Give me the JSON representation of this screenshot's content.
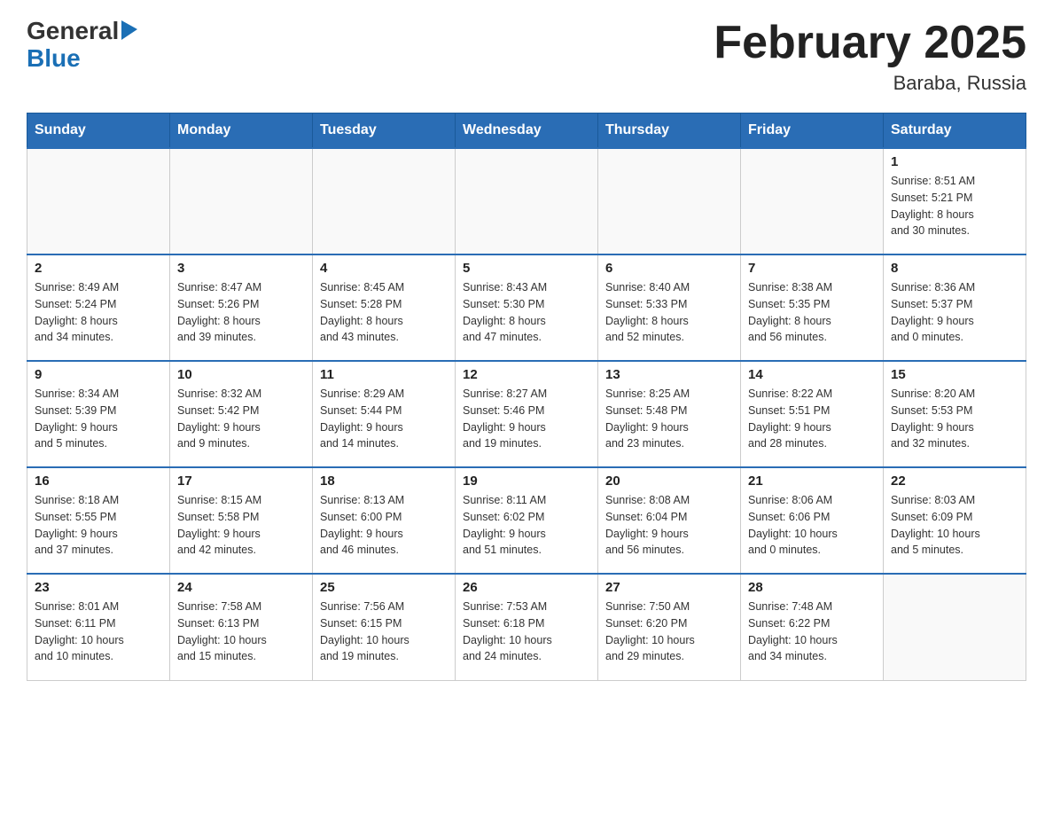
{
  "header": {
    "logo_general": "General",
    "logo_blue": "Blue",
    "title": "February 2025",
    "subtitle": "Baraba, Russia"
  },
  "days_of_week": [
    "Sunday",
    "Monday",
    "Tuesday",
    "Wednesday",
    "Thursday",
    "Friday",
    "Saturday"
  ],
  "weeks": [
    [
      {
        "day": "",
        "info": ""
      },
      {
        "day": "",
        "info": ""
      },
      {
        "day": "",
        "info": ""
      },
      {
        "day": "",
        "info": ""
      },
      {
        "day": "",
        "info": ""
      },
      {
        "day": "",
        "info": ""
      },
      {
        "day": "1",
        "info": "Sunrise: 8:51 AM\nSunset: 5:21 PM\nDaylight: 8 hours\nand 30 minutes."
      }
    ],
    [
      {
        "day": "2",
        "info": "Sunrise: 8:49 AM\nSunset: 5:24 PM\nDaylight: 8 hours\nand 34 minutes."
      },
      {
        "day": "3",
        "info": "Sunrise: 8:47 AM\nSunset: 5:26 PM\nDaylight: 8 hours\nand 39 minutes."
      },
      {
        "day": "4",
        "info": "Sunrise: 8:45 AM\nSunset: 5:28 PM\nDaylight: 8 hours\nand 43 minutes."
      },
      {
        "day": "5",
        "info": "Sunrise: 8:43 AM\nSunset: 5:30 PM\nDaylight: 8 hours\nand 47 minutes."
      },
      {
        "day": "6",
        "info": "Sunrise: 8:40 AM\nSunset: 5:33 PM\nDaylight: 8 hours\nand 52 minutes."
      },
      {
        "day": "7",
        "info": "Sunrise: 8:38 AM\nSunset: 5:35 PM\nDaylight: 8 hours\nand 56 minutes."
      },
      {
        "day": "8",
        "info": "Sunrise: 8:36 AM\nSunset: 5:37 PM\nDaylight: 9 hours\nand 0 minutes."
      }
    ],
    [
      {
        "day": "9",
        "info": "Sunrise: 8:34 AM\nSunset: 5:39 PM\nDaylight: 9 hours\nand 5 minutes."
      },
      {
        "day": "10",
        "info": "Sunrise: 8:32 AM\nSunset: 5:42 PM\nDaylight: 9 hours\nand 9 minutes."
      },
      {
        "day": "11",
        "info": "Sunrise: 8:29 AM\nSunset: 5:44 PM\nDaylight: 9 hours\nand 14 minutes."
      },
      {
        "day": "12",
        "info": "Sunrise: 8:27 AM\nSunset: 5:46 PM\nDaylight: 9 hours\nand 19 minutes."
      },
      {
        "day": "13",
        "info": "Sunrise: 8:25 AM\nSunset: 5:48 PM\nDaylight: 9 hours\nand 23 minutes."
      },
      {
        "day": "14",
        "info": "Sunrise: 8:22 AM\nSunset: 5:51 PM\nDaylight: 9 hours\nand 28 minutes."
      },
      {
        "day": "15",
        "info": "Sunrise: 8:20 AM\nSunset: 5:53 PM\nDaylight: 9 hours\nand 32 minutes."
      }
    ],
    [
      {
        "day": "16",
        "info": "Sunrise: 8:18 AM\nSunset: 5:55 PM\nDaylight: 9 hours\nand 37 minutes."
      },
      {
        "day": "17",
        "info": "Sunrise: 8:15 AM\nSunset: 5:58 PM\nDaylight: 9 hours\nand 42 minutes."
      },
      {
        "day": "18",
        "info": "Sunrise: 8:13 AM\nSunset: 6:00 PM\nDaylight: 9 hours\nand 46 minutes."
      },
      {
        "day": "19",
        "info": "Sunrise: 8:11 AM\nSunset: 6:02 PM\nDaylight: 9 hours\nand 51 minutes."
      },
      {
        "day": "20",
        "info": "Sunrise: 8:08 AM\nSunset: 6:04 PM\nDaylight: 9 hours\nand 56 minutes."
      },
      {
        "day": "21",
        "info": "Sunrise: 8:06 AM\nSunset: 6:06 PM\nDaylight: 10 hours\nand 0 minutes."
      },
      {
        "day": "22",
        "info": "Sunrise: 8:03 AM\nSunset: 6:09 PM\nDaylight: 10 hours\nand 5 minutes."
      }
    ],
    [
      {
        "day": "23",
        "info": "Sunrise: 8:01 AM\nSunset: 6:11 PM\nDaylight: 10 hours\nand 10 minutes."
      },
      {
        "day": "24",
        "info": "Sunrise: 7:58 AM\nSunset: 6:13 PM\nDaylight: 10 hours\nand 15 minutes."
      },
      {
        "day": "25",
        "info": "Sunrise: 7:56 AM\nSunset: 6:15 PM\nDaylight: 10 hours\nand 19 minutes."
      },
      {
        "day": "26",
        "info": "Sunrise: 7:53 AM\nSunset: 6:18 PM\nDaylight: 10 hours\nand 24 minutes."
      },
      {
        "day": "27",
        "info": "Sunrise: 7:50 AM\nSunset: 6:20 PM\nDaylight: 10 hours\nand 29 minutes."
      },
      {
        "day": "28",
        "info": "Sunrise: 7:48 AM\nSunset: 6:22 PM\nDaylight: 10 hours\nand 34 minutes."
      },
      {
        "day": "",
        "info": ""
      }
    ]
  ]
}
